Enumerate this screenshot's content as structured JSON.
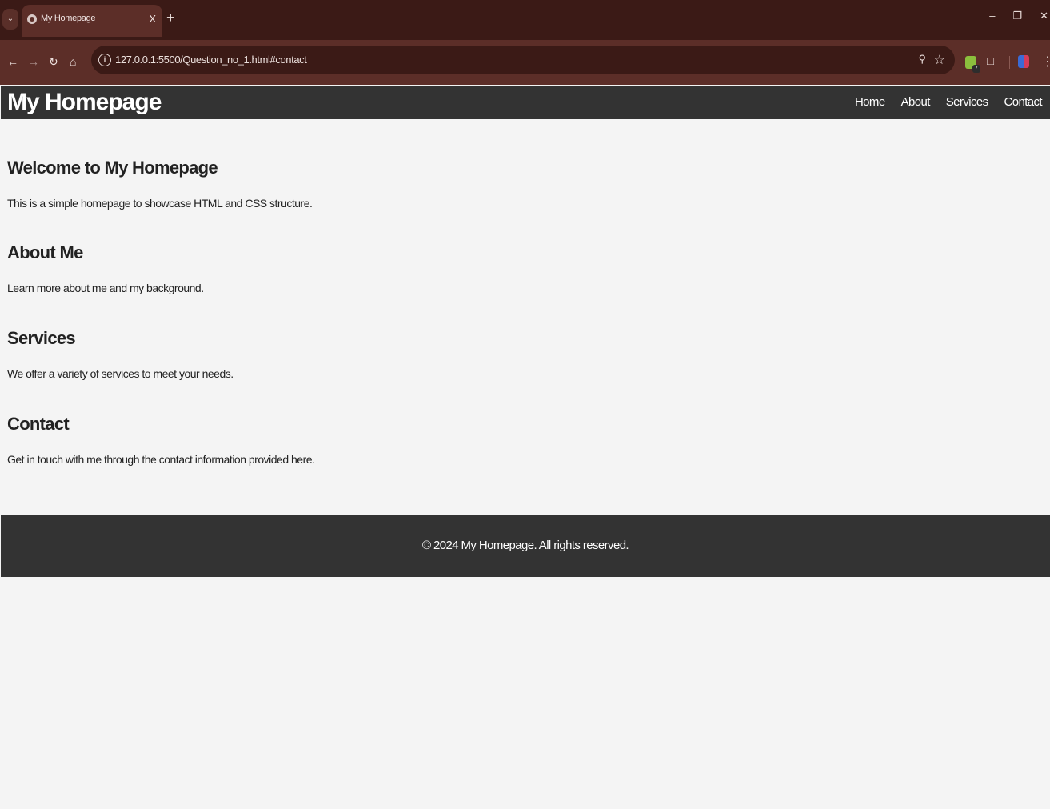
{
  "browser": {
    "tab_title": "My Homepage",
    "tab_close": "X",
    "new_tab": "+",
    "tab_search_icon": "⌄",
    "url": "127.0.0.1:5500/Question_no_1.html#contact",
    "extension_badge": "7",
    "icons": [
      "chevron-down-icon",
      "globe-icon",
      "close-icon",
      "plus-icon",
      "back-icon",
      "forward-icon",
      "reload-icon",
      "home-icon",
      "info-icon",
      "zoom-icon",
      "star-icon",
      "extension-icon",
      "puzzle-icon",
      "profile-icon",
      "menu-icon",
      "minimize-icon",
      "restore-icon",
      "window-close-icon"
    ]
  },
  "site": {
    "title": "My Homepage",
    "nav": [
      "Home",
      "About",
      "Services",
      "Contact"
    ],
    "sections": [
      {
        "heading": "Welcome to My Homepage",
        "text": "This is a simple homepage to showcase HTML and CSS structure."
      },
      {
        "heading": "About Me",
        "text": "Learn more about me and my background."
      },
      {
        "heading": "Services",
        "text": "We offer a variety of services to meet your needs."
      },
      {
        "heading": "Contact",
        "text": "Get in touch with me through the contact information provided here."
      }
    ],
    "footer": "© 2024 My Homepage. All rights reserved."
  },
  "colors": {
    "header_bg": "#333333",
    "page_bg": "#f4f4f4",
    "chrome_tabstrip": "#3b1a16",
    "chrome_toolbar": "#5c2e28"
  }
}
